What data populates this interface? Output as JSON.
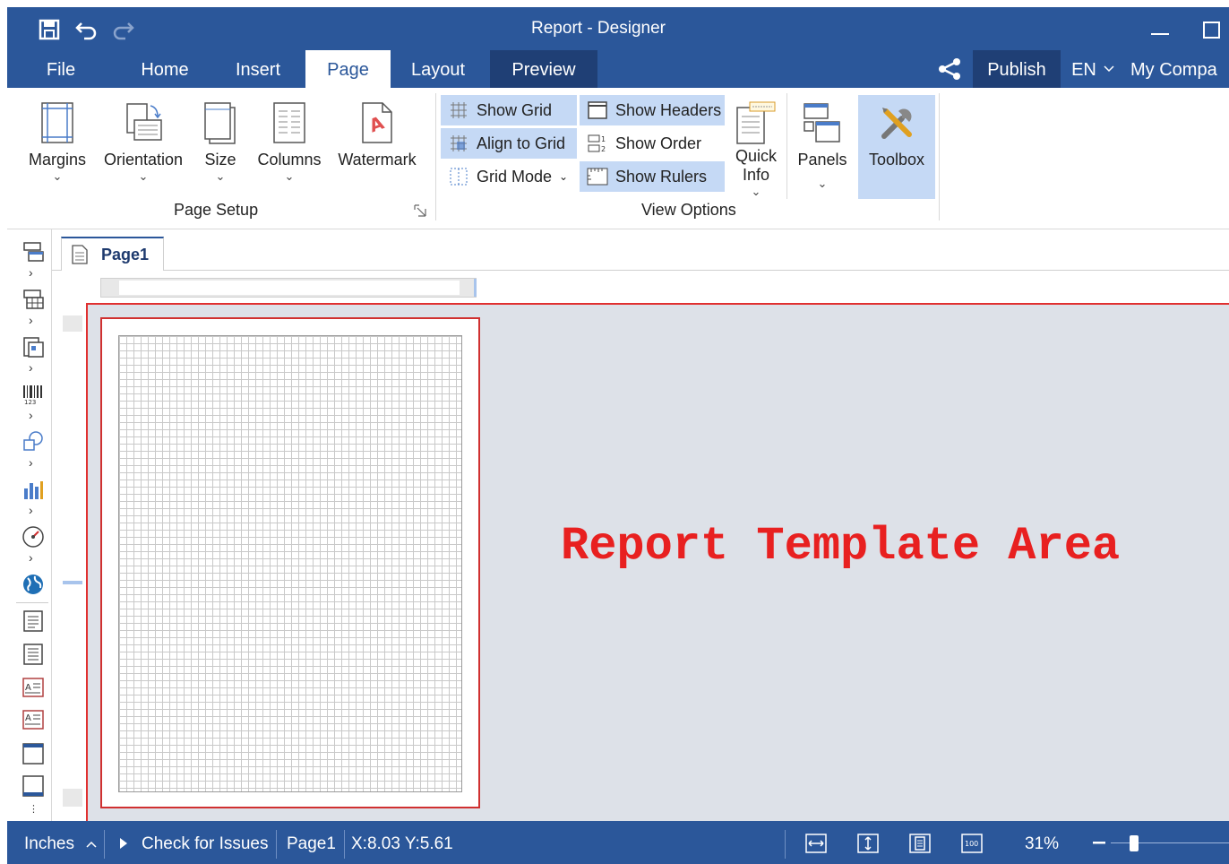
{
  "titlebar": {
    "title": "Report - Designer"
  },
  "tabs": [
    {
      "label": "File"
    },
    {
      "label": "Home"
    },
    {
      "label": "Insert"
    },
    {
      "label": "Page"
    },
    {
      "label": "Layout"
    },
    {
      "label": "Preview"
    }
  ],
  "header_right": {
    "publish": "Publish",
    "language": "EN",
    "company": "My Compa"
  },
  "ribbon": {
    "page_setup": {
      "group_label": "Page Setup",
      "margins": "Margins",
      "orientation": "Orientation",
      "size": "Size",
      "columns": "Columns",
      "watermark": "Watermark"
    },
    "view_options": {
      "group_label": "View Options",
      "show_grid": "Show Grid",
      "align_to_grid": "Align to Grid",
      "grid_mode": "Grid Mode",
      "show_headers": "Show Headers",
      "show_order": "Show Order",
      "show_rulers": "Show Rulers",
      "quick_info_line1": "Quick",
      "quick_info_line2": "Info"
    },
    "panels": "Panels",
    "toolbox": "Toolbox"
  },
  "document": {
    "page_tab": "Page1",
    "template_label": "Report Template Area"
  },
  "statusbar": {
    "units": "Inches",
    "check": "Check for Issues",
    "page": "Page1",
    "coords": "X:8.03 Y:5.61",
    "zoom": "31%"
  },
  "colors": {
    "accent": "#2b579a",
    "ribbon_selected": "#c5d9f5",
    "template_text": "#e82020"
  }
}
